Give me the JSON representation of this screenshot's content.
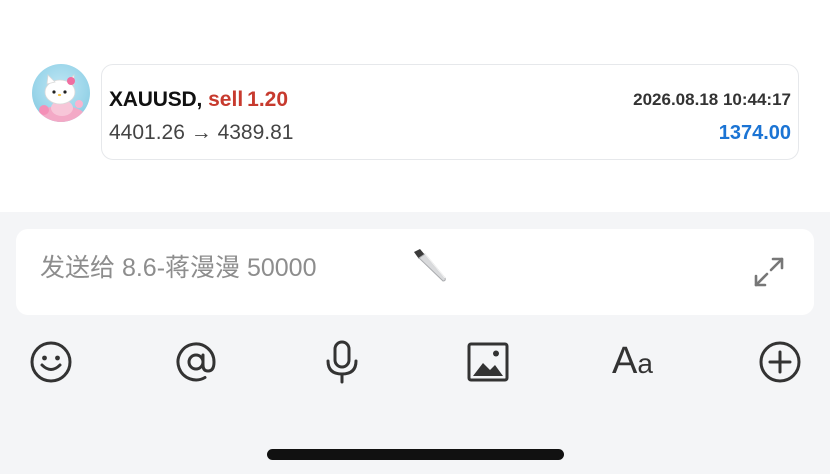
{
  "message": {
    "symbol": "XAUUSD,",
    "side": "sell",
    "volume": "1.20",
    "timestamp": "2026.08.18 10:44:17",
    "price_move": "4401.26 → 4389.81",
    "profit": "1374.00",
    "avatar_icon": "hello-kitty-avatar"
  },
  "composer": {
    "placeholder": "发送给 8.6-蒋漫漫 50000",
    "placeholder_emoji": "knife-icon",
    "expand_icon": "expand-icon"
  },
  "toolbar": {
    "icons": [
      "emoji-icon",
      "mention-icon",
      "microphone-icon",
      "image-icon",
      "font-icon",
      "plus-icon"
    ],
    "font_label_big": "A",
    "font_label_small": "a"
  },
  "colors": {
    "sell": "#c73a2e",
    "profit": "#1b74d4",
    "composer_bg": "#f4f5f7",
    "icon": "#333333"
  }
}
